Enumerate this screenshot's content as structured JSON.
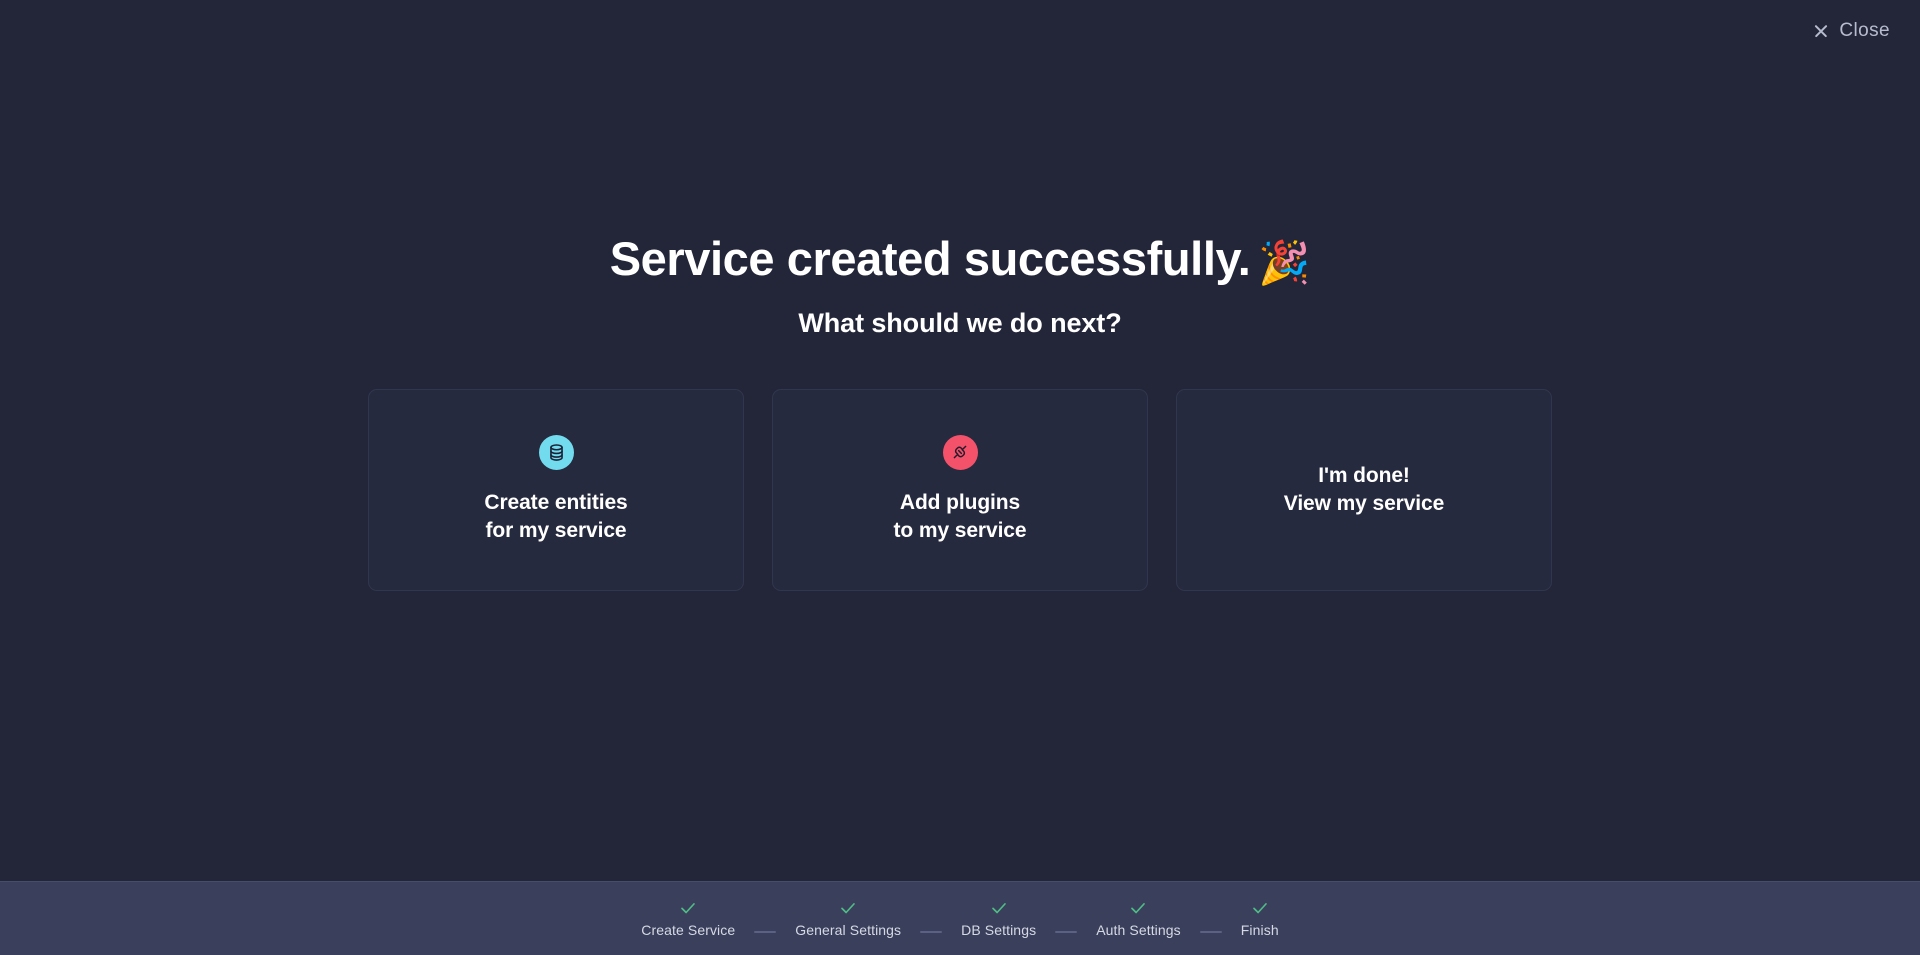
{
  "close": {
    "label": "Close",
    "icon": "close-icon"
  },
  "main": {
    "headline": "Service created successfully.",
    "headline_emoji": "🎉",
    "subhead": "What should we do next?",
    "cards": [
      {
        "icon": "database-icon",
        "icon_bg": "#72dbee",
        "icon_color": "#1b2236",
        "line1": "Create entities",
        "line2": "for my service"
      },
      {
        "icon": "plug-icon",
        "icon_bg": "#f4526b",
        "icon_color": "#241b2b",
        "line1": "Add plugins",
        "line2": "to my service"
      },
      {
        "icon": null,
        "icon_bg": null,
        "icon_color": null,
        "line1": "I'm done!",
        "line2": "View my service"
      }
    ]
  },
  "stepper": {
    "check_color": "#4fbd85",
    "steps": [
      {
        "label": "Create Service",
        "icon": "check-icon",
        "complete": true
      },
      {
        "label": "General Settings",
        "icon": "check-icon",
        "complete": true
      },
      {
        "label": "DB Settings",
        "icon": "check-icon",
        "complete": true
      },
      {
        "label": "Auth Settings",
        "icon": "check-icon",
        "complete": true
      },
      {
        "label": "Finish",
        "icon": "check-icon",
        "complete": true
      }
    ]
  },
  "colors": {
    "background": "#232639",
    "card_bg": "#262a3e",
    "card_border": "#313650",
    "footer_bg": "#3a3f5c",
    "text_primary": "#ffffff",
    "text_muted": "#b6bccd"
  }
}
